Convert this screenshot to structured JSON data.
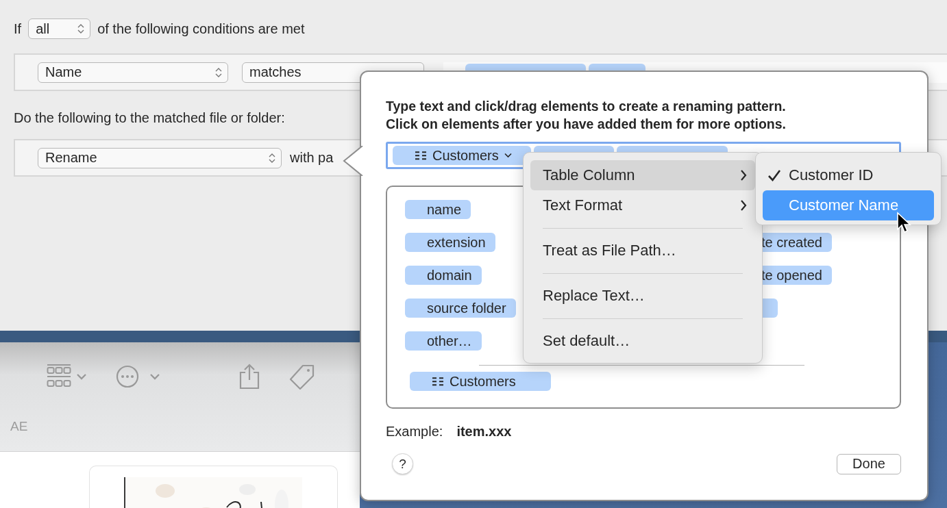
{
  "condition_header": {
    "prefix": "If",
    "quantifier": "all",
    "suffix": "of the following conditions are met"
  },
  "conditions": [
    {
      "attribute": "Name",
      "operator": "matches"
    }
  ],
  "action_header": "Do the following to the matched file or folder:",
  "actions": [
    {
      "action": "Rename",
      "suffix": "with pa"
    }
  ],
  "finder": {
    "label": "AE"
  },
  "popover": {
    "instructions": [
      "Type text and click/drag elements to create a renaming pattern.",
      "Click on elements after you have added them for more options."
    ],
    "pattern_token": "Customers",
    "element_rows": [
      {
        "left": "name",
        "right_hidden": false
      },
      {
        "left": "extension",
        "right": "te created",
        "right_hidden": false
      },
      {
        "left": "domain",
        "right": "te opened",
        "right_hidden": false
      },
      {
        "left": "source folder",
        "right_hidden": true
      },
      {
        "left": "other…",
        "right_hidden": false
      }
    ],
    "table_element": "Customers",
    "example_label": "Example:",
    "example_value": "item.xxx",
    "help": "?",
    "done": "Done"
  },
  "menu": {
    "items": [
      {
        "kind": "item",
        "label": "Table Column",
        "submenu": true,
        "selected": true
      },
      {
        "kind": "item",
        "label": "Text Format",
        "submenu": true,
        "selected": false
      },
      {
        "kind": "separator"
      },
      {
        "kind": "item",
        "label": "Treat as File Path…",
        "submenu": false,
        "selected": false
      },
      {
        "kind": "separator"
      },
      {
        "kind": "item",
        "label": "Replace Text…",
        "submenu": false,
        "selected": false
      },
      {
        "kind": "separator"
      },
      {
        "kind": "item",
        "label": "Set default…",
        "submenu": false,
        "selected": false
      }
    ]
  },
  "submenu": {
    "items": [
      {
        "label": "Customer ID",
        "checked": true,
        "selected": false
      },
      {
        "label": "Customer Name",
        "checked": false,
        "selected": true
      }
    ]
  }
}
